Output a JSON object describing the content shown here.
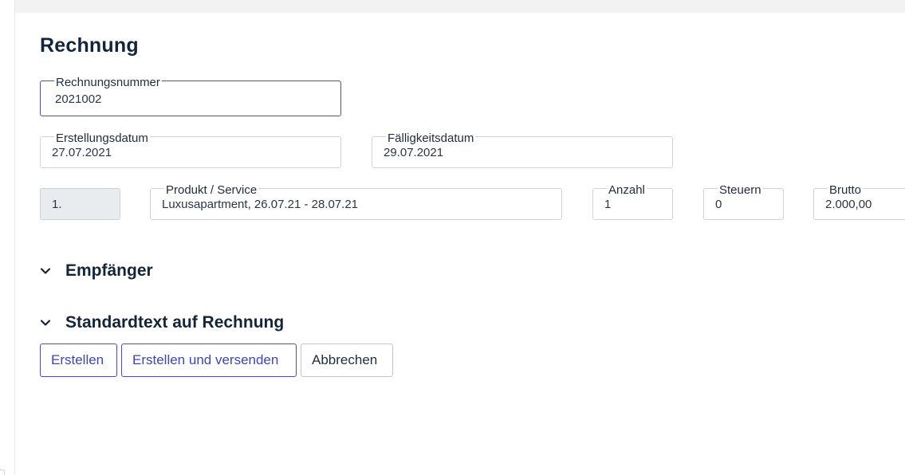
{
  "colors": {
    "accent": "#4a4fb0",
    "heading": "#14253a",
    "border": "#cfd3d8",
    "readonly_bg": "#e9ecef"
  },
  "page": {
    "title": "Rechnung"
  },
  "invoice_number": {
    "label": "Rechnungsnummer",
    "value": "2021002"
  },
  "created_date": {
    "label": "Erstellungsdatum",
    "value": "27.07.2021"
  },
  "due_date": {
    "label": "Fälligkeitsdatum",
    "value": "29.07.2021"
  },
  "line_item": {
    "position": "1.",
    "product": {
      "label": "Produkt / Service",
      "value": "Luxusapartment, 26.07.21 - 28.07.21"
    },
    "quantity": {
      "label": "Anzahl",
      "value": "1"
    },
    "tax": {
      "label": "Steuern",
      "value": "0"
    },
    "gross": {
      "label": "Brutto",
      "value": "2.000,00"
    }
  },
  "sections": {
    "recipient": {
      "title": "Empfänger",
      "icon": "chevron-down-icon"
    },
    "default_text": {
      "title": "Standardtext auf Rechnung",
      "icon": "chevron-down-icon"
    }
  },
  "actions": {
    "create_label": "Erstellen",
    "create_send_label": "Erstellen und versenden",
    "cancel_label": "Abbrechen"
  }
}
